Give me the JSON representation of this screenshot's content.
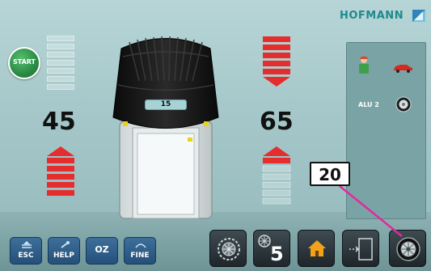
{
  "brand": {
    "name": "HOFMANN",
    "icon": "brand-logo-icon"
  },
  "start": {
    "label": "START"
  },
  "readings": {
    "left_value": "45",
    "right_value": "65"
  },
  "wheel": {
    "position_label": "15"
  },
  "profile": {
    "mode_label": "ALU 2",
    "icons": [
      "operator-icon",
      "car-icon",
      "wheel-icon"
    ]
  },
  "toolbar": {
    "left_buttons": [
      {
        "label": "ESC",
        "icon": "esc-icon"
      },
      {
        "label": "HELP",
        "icon": "help-icon"
      },
      {
        "label": "OZ",
        "icon": ""
      },
      {
        "label": "FINE",
        "icon": "fine-icon"
      }
    ],
    "right_buttons": [
      {
        "label": "",
        "icon": "wheel-measure-icon"
      },
      {
        "label": "5",
        "icon": "spoke-count-icon"
      },
      {
        "label": "",
        "icon": "home-icon"
      },
      {
        "label": "",
        "icon": "distance-icon"
      },
      {
        "label": "",
        "icon": "wheel-type-icon"
      }
    ]
  },
  "callout": {
    "label": "20"
  },
  "colors": {
    "accent_red": "#e52d2d",
    "brand_teal": "#1f8a8e",
    "start_green": "#2a8a44",
    "button_blue": "#24507a"
  }
}
